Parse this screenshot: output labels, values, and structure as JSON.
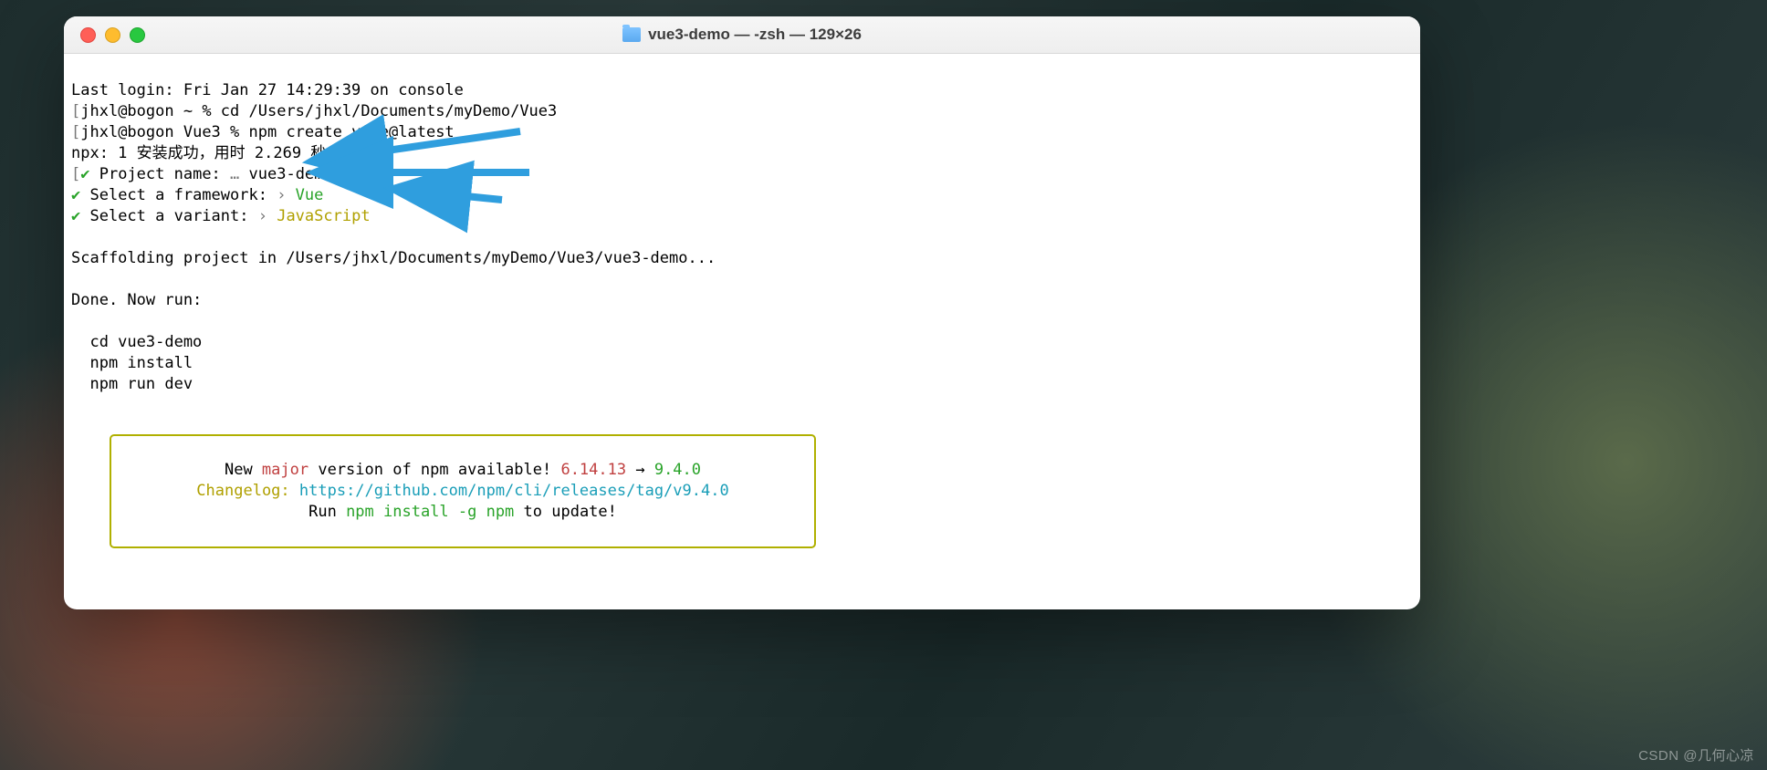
{
  "titlebar": {
    "title": "vue3-demo — -zsh — 129×26"
  },
  "term": {
    "last_login": "Last login: Fri Jan 27 14:29:39 on console",
    "prompt1_open": "[",
    "prompt1_user": "jhxl@bogon",
    "prompt1_path": " ~ % ",
    "cmd1": "cd /Users/jhxl/Documents/myDemo/Vue3",
    "prompt2_open": "[",
    "prompt2_user": "jhxl@bogon",
    "prompt2_path": " Vue3 % ",
    "cmd2": "npm create vite@latest",
    "npx_line": "npx: 1 安装成功，用时 2.269 秒",
    "q1_open": "[",
    "q1_label": " Project name: ",
    "q1_ellipsis": "… ",
    "q1_value": "vue3-demo",
    "q2_label": " Select a framework: ",
    "q2_arrow": "› ",
    "q2_value": "Vue",
    "q3_label": " Select a variant: ",
    "q3_arrow": "› ",
    "q3_value": "JavaScript",
    "scaffold": "Scaffolding project in /Users/jhxl/Documents/myDemo/Vue3/vue3-demo...",
    "done": "Done. Now run:",
    "run1": "  cd vue3-demo",
    "run2": "  npm install",
    "run3": "  npm run dev"
  },
  "notice": {
    "l1_a": "New ",
    "l1_major": "major",
    "l1_b": " version of npm available! ",
    "l1_old": "6.14.13",
    "l1_arrow": " → ",
    "l1_new": "9.4.0",
    "l2_a": "Changelog: ",
    "l2_url": "https://github.com/npm/cli/releases/tag/v9.4.0",
    "l3_a": "Run ",
    "l3_cmd": "npm install -g npm",
    "l3_b": " to update!"
  },
  "watermark": "CSDN @几何心凉",
  "colors": {
    "green": "#29a329",
    "yellow": "#b0a000",
    "red": "#c04040",
    "cyan": "#1a9eb8",
    "arrow": "#2f9ede"
  }
}
